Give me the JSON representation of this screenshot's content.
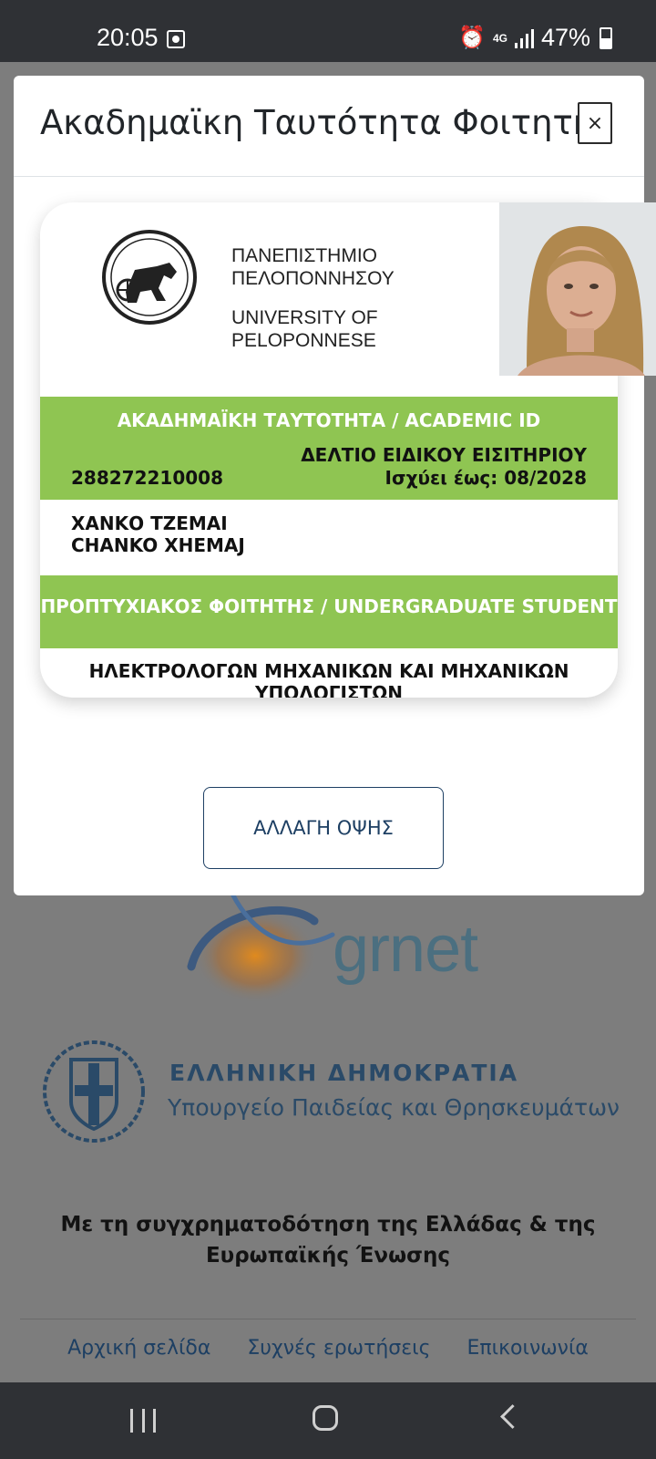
{
  "status_bar": {
    "time": "20:05",
    "network": "4G",
    "battery": "47%",
    "icons": [
      "screen-record-icon",
      "alarm-icon",
      "signal-icon",
      "battery-icon"
    ]
  },
  "modal": {
    "title": "Ακαδημαϊκη Ταυτότητα Φοιτητή",
    "close_label": "×",
    "flip_button": "ΑΛΛΑΓΗ ΟΨΗΣ"
  },
  "card": {
    "university_gr": "ΠΑΝΕΠΙΣΤΗΜΙΟ\nΠΕΛΟΠΟΝΝΗΣΟΥ",
    "university_en": "UNIVERSITY OF\nPELOPONNESE",
    "id_title": "ΑΚΑΔΗΜΑΪΚΗ ΤΑΥΤΟΤΗΤΑ / ACADEMIC ID",
    "id_number": "288272210008",
    "ticket": "ΔΕΛΤΙΟ ΕΙΔΙΚΟΥ ΕΙΣΙΤΗΡΙΟΥ",
    "valid_until": "Ισχύει έως: 08/2028",
    "name_gr": "ΧΑΝΚΟ ΤΖΕΜΑΙ",
    "name_en": "CHANKO XHEMAJ",
    "student_type": "ΠΡΟΠΤΥΧΙΑΚΟΣ ΦΟΙΤΗΤΗΣ / UNDERGRADUATE STUDENT",
    "department": "ΗΛΕΚΤΡΟΛΟΓΩΝ ΜΗΧΑΝΙΚΩΝ ΚΑΙ ΜΗΧΑΝΙΚΩΝ\nΥΠΟΛΟΓΙΣΤΩΝ",
    "accent_color": "#8fc552"
  },
  "background": {
    "grnet_logo_text": "grnet",
    "gov_title": "ΕΛΛΗΝΙΚΗ ΔΗΜΟΚΡΑΤΙΑ",
    "gov_subtitle": "Υπουργείο Παιδείας και Θρησκευμάτων",
    "cofunding": "Με τη συγχρηματοδότηση της Ελλάδας & της Ευρωπαϊκής Ένωσης",
    "footer_links": [
      "Αρχική σελίδα",
      "Συχνές ερωτήσεις",
      "Επικοινωνία"
    ]
  }
}
